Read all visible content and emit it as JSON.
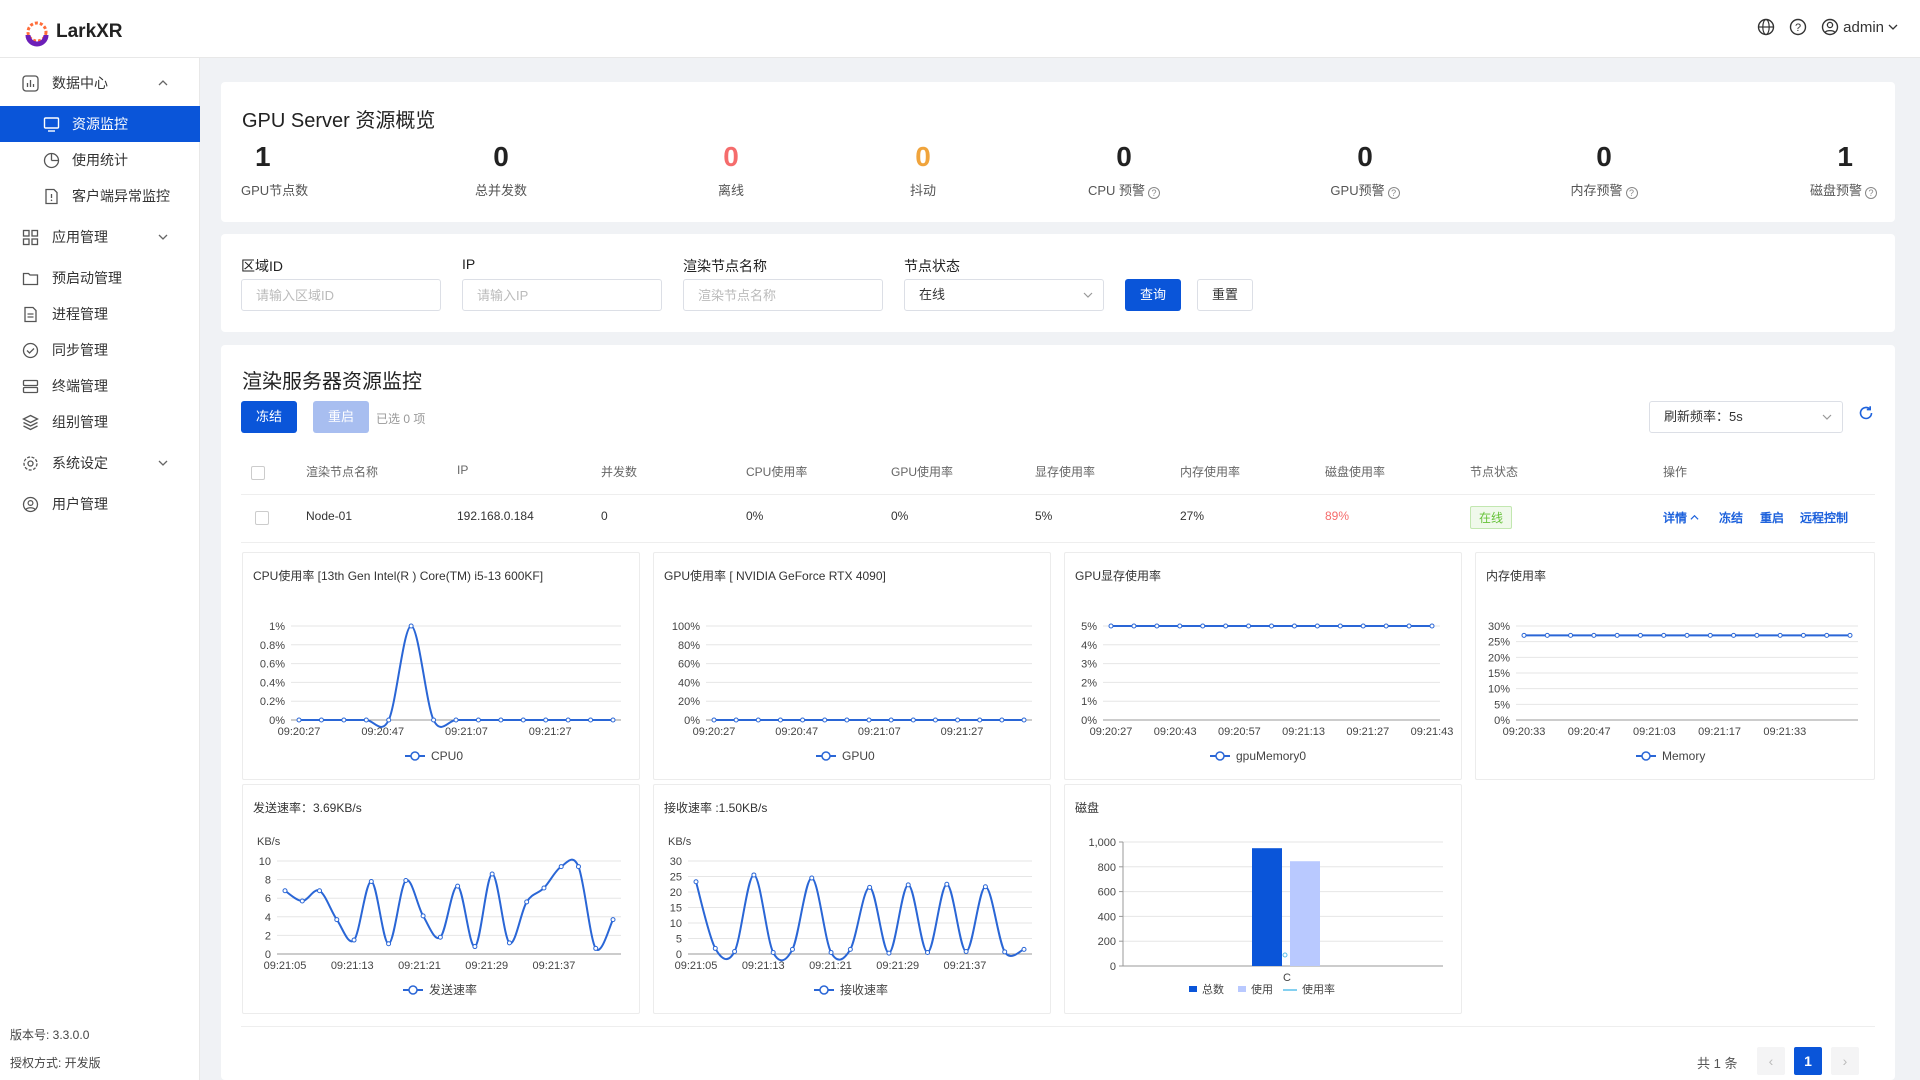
{
  "app": {
    "name": "LarkXR",
    "user": "admin"
  },
  "sidebar": {
    "items": [
      {
        "label": "数据中心",
        "icon": "chart-board-icon"
      },
      {
        "label": "资源监控",
        "icon": "monitor-icon"
      },
      {
        "label": "使用统计",
        "icon": "pie-chart-icon"
      },
      {
        "label": "客户端异常监控",
        "icon": "document-alert-icon"
      },
      {
        "label": "应用管理",
        "icon": "apps-grid-icon"
      },
      {
        "label": "预启动管理",
        "icon": "folder-icon"
      },
      {
        "label": "进程管理",
        "icon": "file-list-icon"
      },
      {
        "label": "同步管理",
        "icon": "check-circle-icon"
      },
      {
        "label": "终端管理",
        "icon": "server-icon"
      },
      {
        "label": "组别管理",
        "icon": "layers-icon"
      },
      {
        "label": "系统设定",
        "icon": "gear-icon"
      },
      {
        "label": "用户管理",
        "icon": "user-icon"
      }
    ],
    "version": "版本号: 3.3.0.0",
    "license": "授权方式: 开发版"
  },
  "overview": {
    "title": "GPU Server 资源概览",
    "stats": [
      {
        "value": "1",
        "label": "GPU节点数",
        "color": "#222222"
      },
      {
        "value": "0",
        "label": "总并发数",
        "color": "#222222"
      },
      {
        "value": "0",
        "label": "离线",
        "color": "#f56c6c"
      },
      {
        "value": "0",
        "label": "抖动",
        "color": "#f0a43c"
      },
      {
        "value": "0",
        "label": "CPU 预警",
        "color": "#222222"
      },
      {
        "value": "0",
        "label": "GPU预警",
        "color": "#222222"
      },
      {
        "value": "0",
        "label": "内存预警",
        "color": "#222222"
      },
      {
        "value": "1",
        "label": "磁盘预警",
        "color": "#222222"
      }
    ]
  },
  "filters": {
    "region_label": "区域ID",
    "region_placeholder": "请输入区域ID",
    "ip_label": "IP",
    "ip_placeholder": "请输入IP",
    "node_label": "渲染节点名称",
    "node_placeholder": "渲染节点名称",
    "status_label": "节点状态",
    "status_value": "在线",
    "query": "查询",
    "reset": "重置"
  },
  "monitor": {
    "title": "渲染服务器资源监控",
    "freeze": "冻结",
    "restart": "重启",
    "selected": "已选 0 项",
    "refresh": "刷新频率：5s",
    "headers": [
      "渲染节点名称",
      "IP",
      "并发数",
      "CPU使用率",
      "GPU使用率",
      "显存使用率",
      "内存使用率",
      "磁盘使用率",
      "节点状态",
      "操作"
    ],
    "row": {
      "node": "Node-01",
      "ip": "192.168.0.184",
      "conc": "0",
      "cpu": "0%",
      "gpu": "0%",
      "vram": "5%",
      "mem": "27%",
      "disk": "89%",
      "status": "在线"
    },
    "actions": {
      "detail": "详情",
      "freeze": "冻结",
      "restart": "重启",
      "remote": "远程控制"
    },
    "pager": {
      "total": "共 1 条",
      "page": "1"
    }
  },
  "chart_data": [
    {
      "type": "line",
      "title": "CPU使用率 [13th Gen Intel(R ) Core(TM) i5-13 600KF]",
      "y_ticks": [
        "1%",
        "0.8%",
        "0.6%",
        "0.4%",
        "0.2%",
        "0%"
      ],
      "ylim": [
        0,
        1
      ],
      "x_ticks": [
        "09:20:27",
        "09:20:47",
        "09:21:07",
        "09:21:27"
      ],
      "series": [
        {
          "name": "CPU0",
          "values": [
            0,
            0,
            0,
            0,
            0,
            1,
            0,
            0,
            0,
            0,
            0,
            0,
            0,
            0,
            0
          ]
        }
      ]
    },
    {
      "type": "line",
      "title": "GPU使用率 [ NVIDIA GeForce RTX 4090]",
      "y_ticks": [
        "100%",
        "80%",
        "60%",
        "40%",
        "20%",
        "0%"
      ],
      "ylim": [
        0,
        100
      ],
      "x_ticks": [
        "09:20:27",
        "09:20:47",
        "09:21:07",
        "09:21:27"
      ],
      "series": [
        {
          "name": "GPU0",
          "values": [
            0,
            0,
            0,
            0,
            0,
            0,
            0,
            0,
            0,
            0,
            0,
            0,
            0,
            0,
            0
          ]
        }
      ]
    },
    {
      "type": "line",
      "title": "GPU显存使用率",
      "y_ticks": [
        "5%",
        "4%",
        "3%",
        "2%",
        "1%",
        "0%"
      ],
      "ylim": [
        0,
        5
      ],
      "x_ticks": [
        "09:20:27",
        "09:20:43",
        "09:20:57",
        "09:21:13",
        "09:21:27",
        "09:21:43"
      ],
      "series": [
        {
          "name": "gpuMemory0",
          "values": [
            5,
            5,
            5,
            5,
            5,
            5,
            5,
            5,
            5,
            5,
            5,
            5,
            5,
            5,
            5
          ]
        }
      ]
    },
    {
      "type": "line",
      "title": "内存使用率",
      "y_ticks": [
        "30%",
        "25%",
        "20%",
        "15%",
        "10%",
        "5%",
        "0%"
      ],
      "ylim": [
        0,
        30
      ],
      "x_ticks": [
        "09:20:33",
        "09:20:47",
        "09:21:03",
        "09:21:17",
        "09:21:33"
      ],
      "series": [
        {
          "name": "Memory",
          "values": [
            27,
            27,
            27,
            27,
            27,
            27,
            27,
            27,
            27,
            27,
            27,
            27,
            27,
            27,
            27
          ]
        }
      ]
    },
    {
      "type": "line",
      "title": "发送速率：3.69KB/s",
      "unit": "KB/s",
      "y_ticks": [
        "10",
        "8",
        "6",
        "4",
        "2",
        "0"
      ],
      "ylim": [
        0,
        10
      ],
      "x_ticks": [
        "09:21:05",
        "09:21:13",
        "09:21:21",
        "09:21:29",
        "09:21:37"
      ],
      "series": [
        {
          "name": "发送速率",
          "values": [
            6.8,
            5.7,
            6.8,
            3.7,
            1.5,
            7.8,
            1.1,
            7.9,
            4.1,
            1.8,
            7.3,
            0.8,
            8.6,
            1.2,
            5.6,
            7.1,
            9.4,
            9.4,
            0.6,
            3.7
          ]
        }
      ]
    },
    {
      "type": "line",
      "title": "接收速率 :1.50KB/s",
      "unit": "KB/s",
      "y_ticks": [
        "30",
        "25",
        "20",
        "15",
        "10",
        "5",
        "0"
      ],
      "ylim": [
        0,
        30
      ],
      "x_ticks": [
        "09:21:05",
        "09:21:13",
        "09:21:21",
        "09:21:29",
        "09:21:37"
      ],
      "series": [
        {
          "name": "接收速率",
          "values": [
            23.3,
            1.8,
            0.8,
            25.5,
            0.5,
            1.5,
            24.5,
            0.5,
            1.5,
            21.5,
            0.3,
            22.3,
            0.5,
            22.5,
            0.8,
            21.7,
            0.7,
            1.5
          ]
        }
      ]
    },
    {
      "type": "bar",
      "title": "磁盘",
      "y_ticks": [
        "1,000",
        "800",
        "600",
        "400",
        "200",
        "0"
      ],
      "ylim": [
        0,
        1000
      ],
      "categories": [
        "C"
      ],
      "series": [
        {
          "name": "总数",
          "values": [
            950
          ]
        },
        {
          "name": "使用",
          "values": [
            845
          ]
        },
        {
          "name": "使用率",
          "values": [
            89
          ]
        }
      ]
    }
  ],
  "colors": {
    "accent": "#0a55d9",
    "line": "#2a66d6",
    "bar_used": "#b9c9ff",
    "warning": "#f56c6c",
    "online_bg": "#f0f9eb",
    "online_text": "#67c23a"
  }
}
